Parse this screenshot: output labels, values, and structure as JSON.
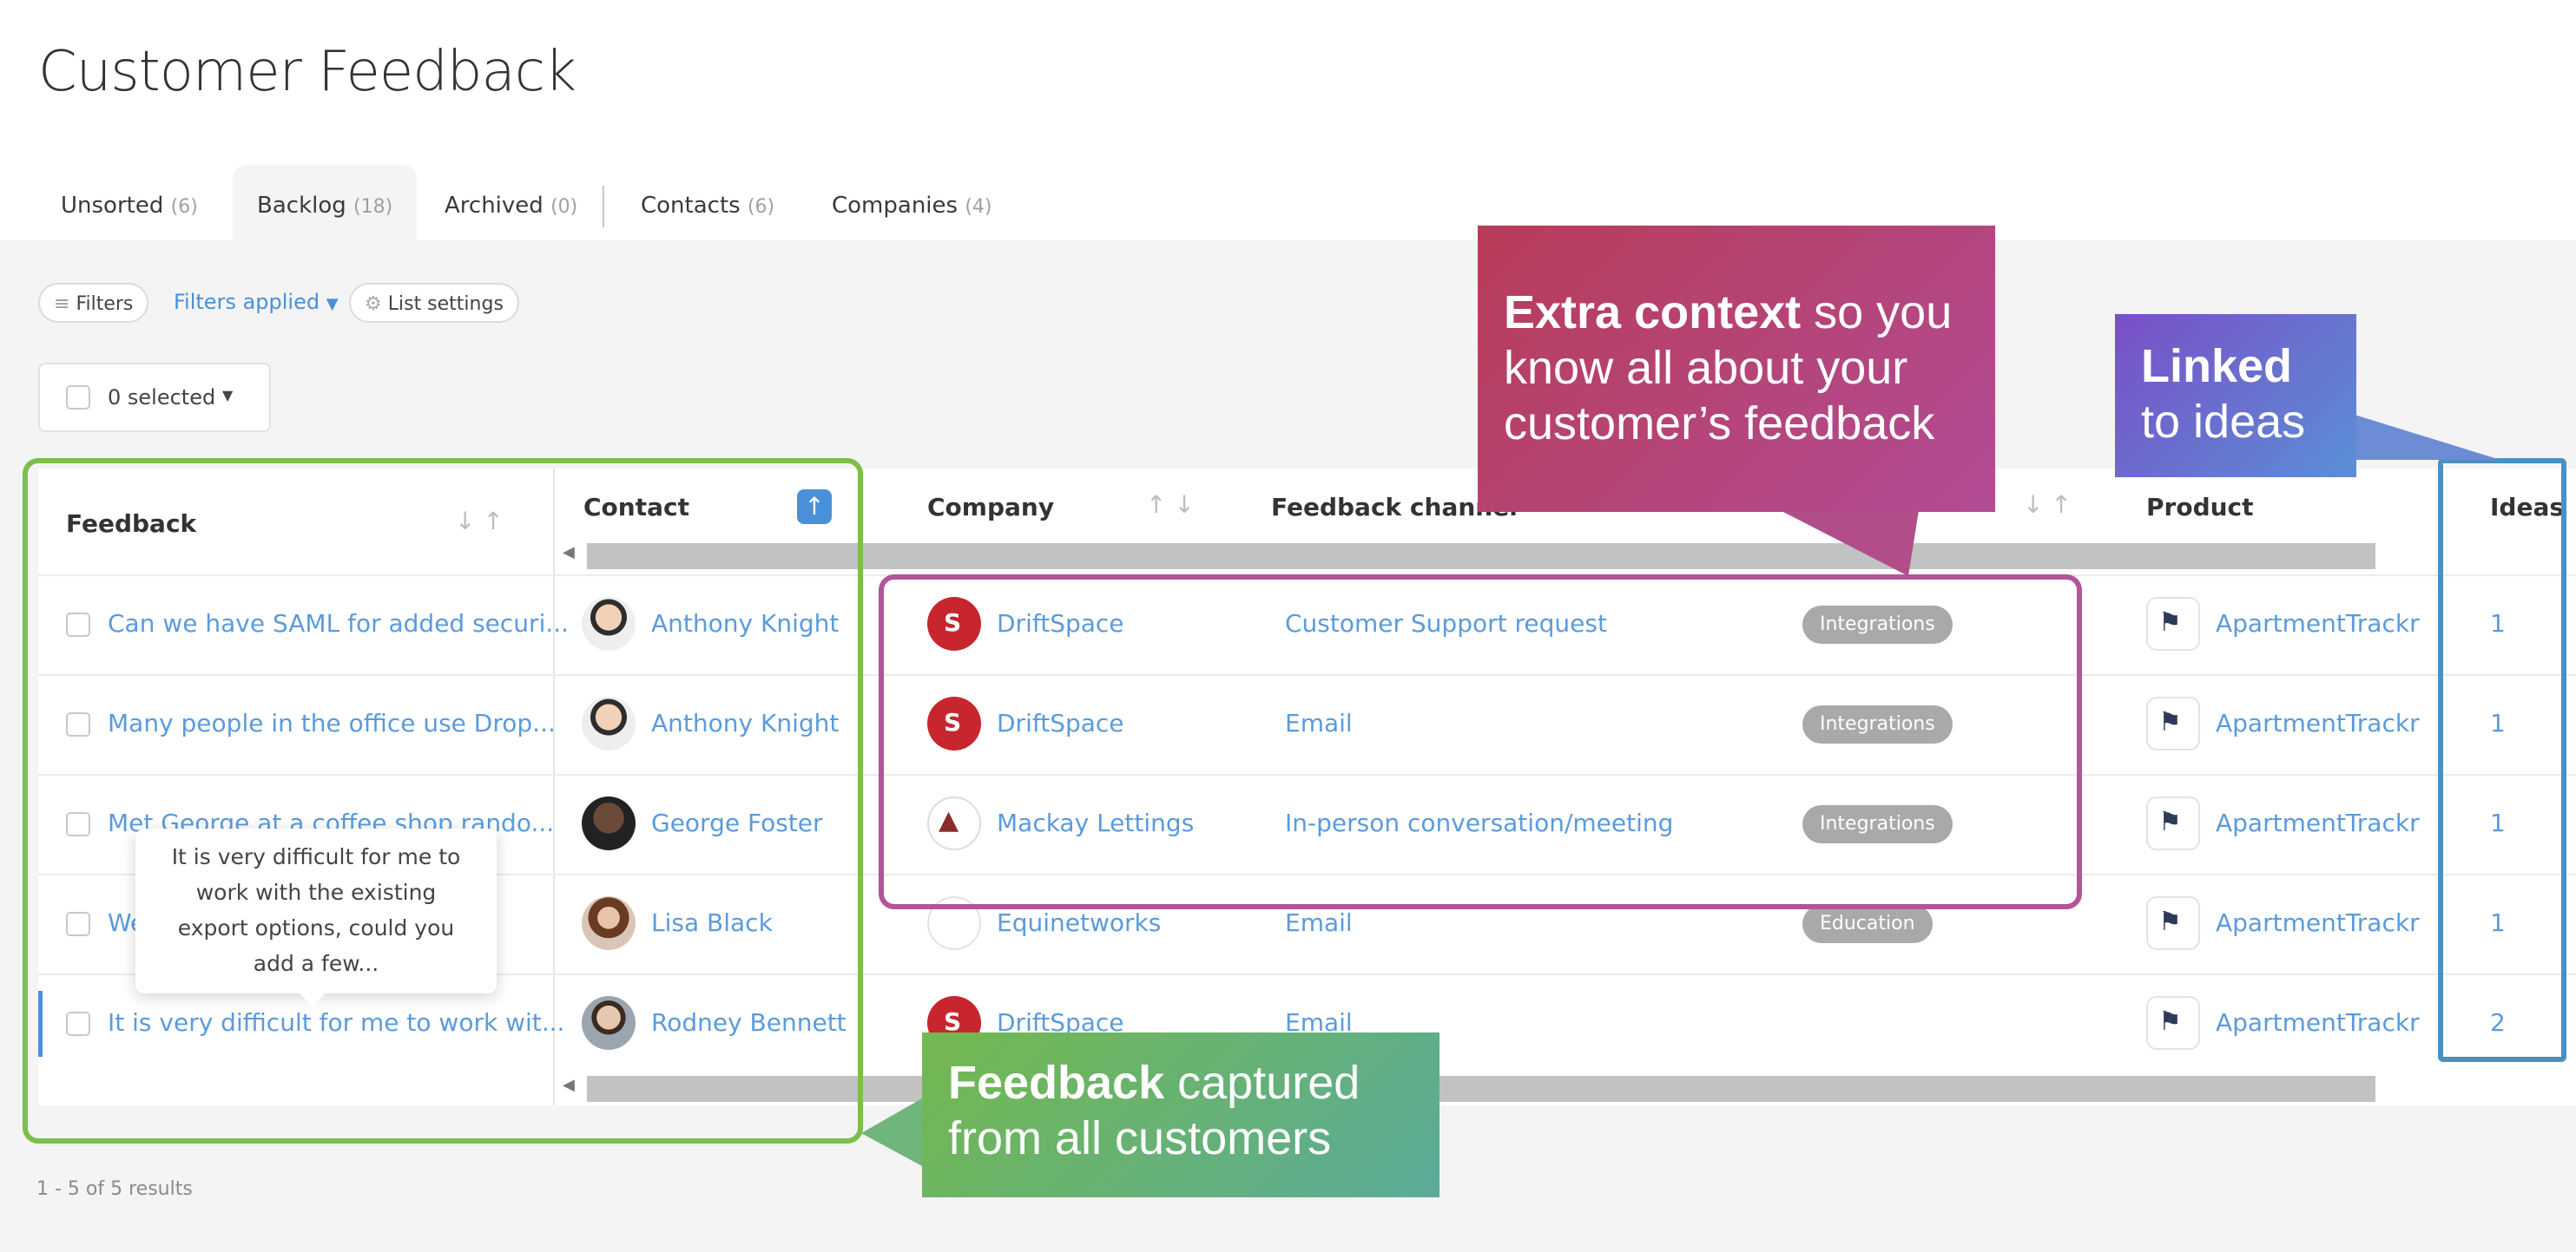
{
  "page": {
    "title": "Customer Feedback"
  },
  "tabs": [
    {
      "label": "Unsorted",
      "count": "(6)"
    },
    {
      "label": "Backlog",
      "count": "(18)"
    },
    {
      "label": "Archived",
      "count": "(0)"
    },
    {
      "label": "Contacts",
      "count": "(6)"
    },
    {
      "label": "Companies",
      "count": "(4)"
    }
  ],
  "toolbar": {
    "filters_label": "Filters",
    "filters_applied_label": "Filters applied",
    "list_settings_label": "List settings",
    "selected_label": "0 selected"
  },
  "columns": {
    "feedback": "Feedback",
    "contact": "Contact",
    "company": "Company",
    "channel": "Feedback channel",
    "product": "Product",
    "ideas": "Ideas"
  },
  "rows": [
    {
      "feedback": "Can we have SAML for added securi...",
      "contact": "Anthony Knight",
      "company": "DriftSpace",
      "channel": "Customer Support request",
      "tag": "Integrations",
      "product": "ApartmentTrackr",
      "ideas": "1"
    },
    {
      "feedback": "Many people in the office use Drop...",
      "contact": "Anthony Knight",
      "company": "DriftSpace",
      "channel": "Email",
      "tag": "Integrations",
      "product": "ApartmentTrackr",
      "ideas": "1"
    },
    {
      "feedback": "Met George at a coffee shop rando...",
      "contact": "George Foster",
      "company": "Mackay Lettings",
      "channel": "In-person conversation/meeting",
      "tag": "Integrations",
      "product": "ApartmentTrackr",
      "ideas": "1"
    },
    {
      "feedback": "We...",
      "contact": "Lisa Black",
      "company": "Equinetworks",
      "channel": "Email",
      "tag": "Education",
      "product": "ApartmentTrackr",
      "ideas": "1"
    },
    {
      "feedback": "It is very difficult for me to work wit...",
      "contact": "Rodney Bennett",
      "company": "DriftSpace",
      "channel": "Email",
      "tag": "",
      "product": "ApartmentTrackr",
      "ideas": "2"
    }
  ],
  "tooltip": {
    "text": "It is very difficult for me to work with the existing export options, could you add a few..."
  },
  "footer": {
    "results": "1 - 5 of 5 results"
  },
  "callouts": {
    "context_bold": "Extra context",
    "context_rest": " so you know all about your customer’s feedback",
    "linked_bold": "Linked",
    "linked_rest": "to ideas",
    "feedback_bold": "Feedback",
    "feedback_rest": " captured from all customers"
  },
  "colors": {
    "link": "#5a9bdc",
    "green_frame": "#7cbf4a",
    "magenta_frame": "#b4549a",
    "blue_frame": "#4b90c2",
    "active_sort": "#4a90d9"
  }
}
